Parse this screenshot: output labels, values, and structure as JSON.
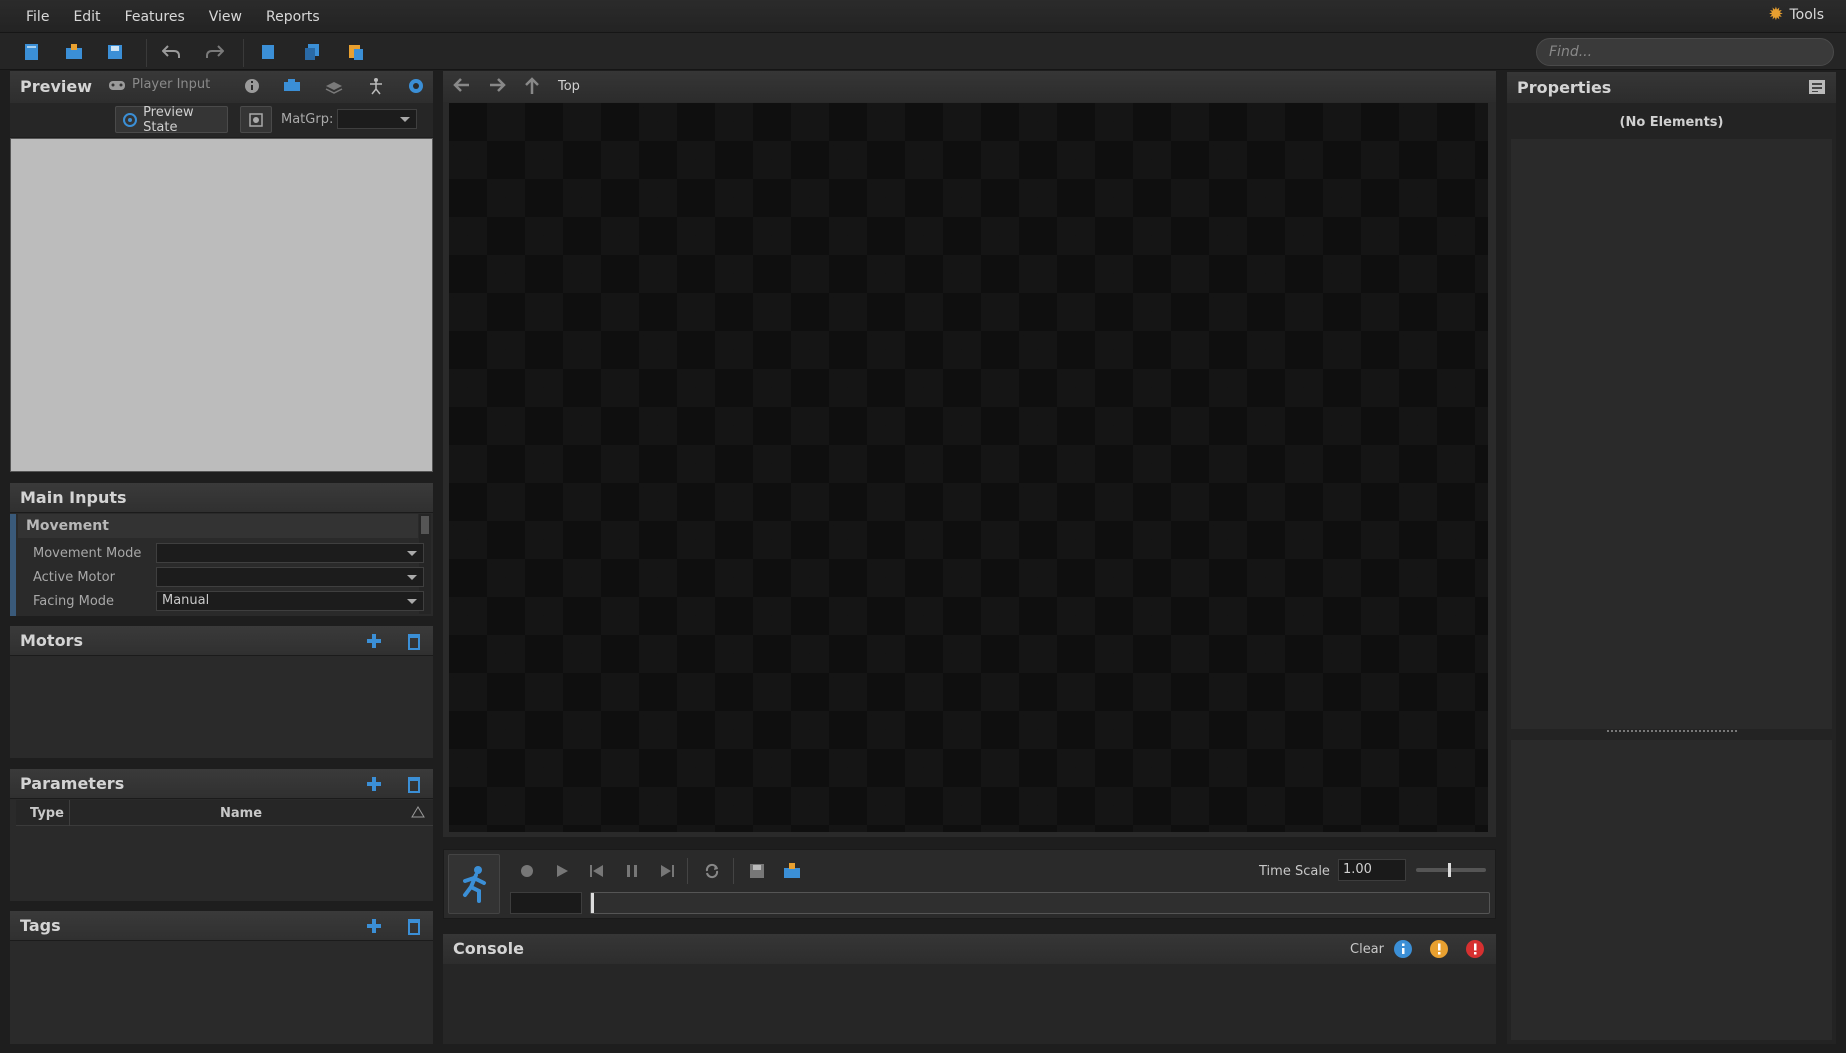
{
  "menubar": {
    "items": [
      "File",
      "Edit",
      "Features",
      "View",
      "Reports"
    ],
    "tools_label": "Tools"
  },
  "toolbar": {
    "search_placeholder": "Find..."
  },
  "preview": {
    "title": "Preview",
    "player_input_label": "Player Input",
    "preview_state_label": "Preview State",
    "matgrp_label": "MatGrp:"
  },
  "main_inputs": {
    "title": "Main Inputs",
    "section": "Movement",
    "rows": [
      {
        "label": "Movement Mode",
        "value": ""
      },
      {
        "label": "Active Motor",
        "value": ""
      },
      {
        "label": "Facing Mode",
        "value": "Manual"
      }
    ]
  },
  "motors": {
    "title": "Motors"
  },
  "parameters": {
    "title": "Parameters",
    "columns": [
      "Type",
      "Name"
    ]
  },
  "tags": {
    "title": "Tags"
  },
  "graph": {
    "breadcrumb": "Top"
  },
  "playback": {
    "time_scale_label": "Time Scale",
    "time_scale_value": "1.00"
  },
  "console": {
    "title": "Console",
    "clear_label": "Clear"
  },
  "properties": {
    "title": "Properties",
    "empty_label": "(No Elements)"
  },
  "colors": {
    "accent_blue": "#3b8fd6",
    "warning": "#e8a030",
    "error": "#d63030"
  }
}
